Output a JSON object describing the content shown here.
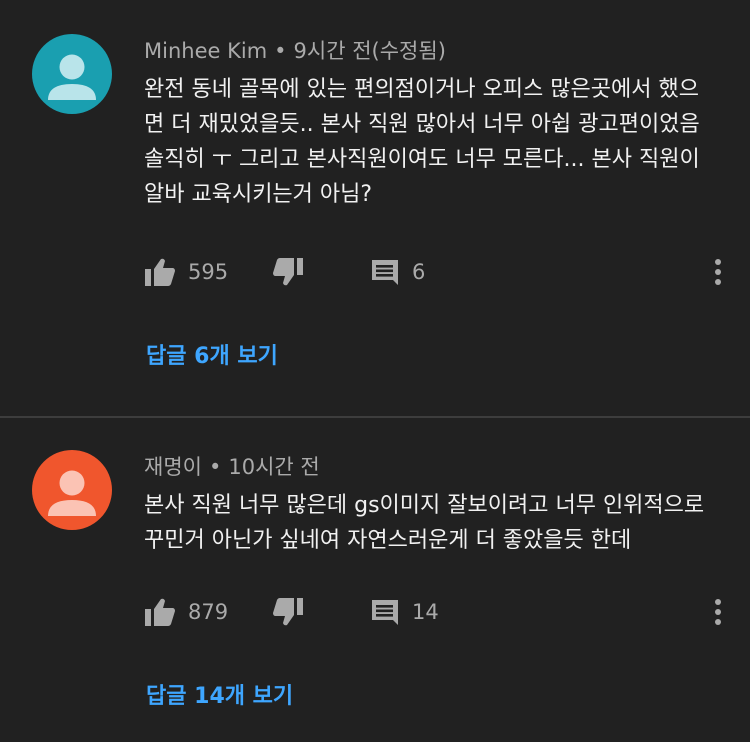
{
  "comments": [
    {
      "author": "Minhee Kim",
      "separator": "•",
      "time": "9시간 전(수정됨)",
      "avatar_color": "#1a9fb0",
      "text_lines": [
        "완전 동네 골목에 있는 편의점이거나 오피스 많은곳에서 했으",
        "면 더 재밌었을듯.. 본사 직원 많아서 너무 아쉽 광고편이었음",
        "솔직히 ㅜ 그리고 본사직원이여도 너무 모른다... 본사 직원이",
        "알바 교육시키는거 아님?"
      ],
      "likes": "595",
      "replies_count": "6",
      "view_replies": "답글 6개 보기"
    },
    {
      "author": "재명이",
      "separator": "•",
      "time": "10시간 전",
      "avatar_color": "#f0562d",
      "text_lines": [
        "본사 직원 너무 많은데 gs이미지 잘보이려고 너무 인위적으로",
        "꾸민거 아닌가 싶네여 자연스러운게 더 좋았을듯 한데"
      ],
      "likes": "879",
      "replies_count": "14",
      "view_replies": "답글 14개 보기"
    }
  ],
  "icons": {
    "like": "thumbs-up-icon",
    "dislike": "thumbs-down-icon",
    "reply": "comment-icon",
    "more": "more-vert-icon"
  },
  "colors": {
    "background": "#212121",
    "link": "#3ea6ff",
    "secondary_text": "#aaaaaa"
  }
}
